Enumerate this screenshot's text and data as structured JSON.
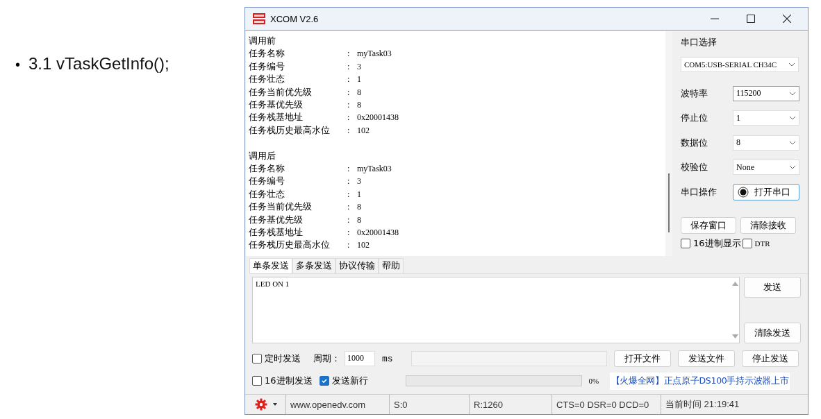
{
  "slide": {
    "bullet": "•",
    "heading": "3.1 vTaskGetInfo();"
  },
  "window": {
    "title": "XCOM V2.6"
  },
  "receive": {
    "sections": [
      {
        "heading": "调用前",
        "rows": [
          {
            "label": "任务名称",
            "separator": ":",
            "value": "myTask03"
          },
          {
            "label": "任务编号",
            "separator": ":",
            "value": "3"
          },
          {
            "label": "任务壮态",
            "separator": ":",
            "value": "1"
          },
          {
            "label": "任务当前优先级",
            "separator": ":",
            "value": "8"
          },
          {
            "label": "任务基优先级",
            "separator": ":",
            "value": "8"
          },
          {
            "label": "任务栈基地址",
            "separator": ":",
            "value": "0x20001438"
          },
          {
            "label": "任务栈历史最高水位",
            "separator": ":",
            "value": "102"
          }
        ]
      },
      {
        "heading": "调用后",
        "rows": [
          {
            "label": "任务名称",
            "separator": ":",
            "value": "myTask03"
          },
          {
            "label": "任务编号",
            "separator": ":",
            "value": "3"
          },
          {
            "label": "任务壮态",
            "separator": ":",
            "value": "1"
          },
          {
            "label": "任务当前优先级",
            "separator": ":",
            "value": "8"
          },
          {
            "label": "任务基优先级",
            "separator": ":",
            "value": "8"
          },
          {
            "label": "任务栈基地址",
            "separator": ":",
            "value": "0x20001438"
          },
          {
            "label": "任务栈历史最高水位",
            "separator": ":",
            "value": "102"
          }
        ]
      }
    ]
  },
  "serial_panel": {
    "port_label": "串口选择",
    "port": "COM5:USB-SERIAL CH34C",
    "settings": [
      {
        "label": "波特率",
        "value": "115200"
      },
      {
        "label": "停止位",
        "value": "1"
      },
      {
        "label": "数据位",
        "value": "8"
      },
      {
        "label": "校验位",
        "value": "None"
      }
    ],
    "operation": {
      "label": "串口操作",
      "button": "打开串口"
    },
    "buttons": [
      "保存窗口",
      "清除接收"
    ],
    "checkboxes": [
      {
        "label": "16进制显示",
        "checked": false
      },
      {
        "label": "DTR",
        "checked": false
      }
    ]
  },
  "send_tabs": [
    {
      "label": "单条发送",
      "selected": true
    },
    {
      "label": "多条发送",
      "selected": false
    },
    {
      "label": "协议传输",
      "selected": false
    },
    {
      "label": "帮助",
      "selected": false
    }
  ],
  "send_text": "LED ON 1",
  "send_buttons": [
    "发送",
    "清除发送"
  ],
  "timed_send": {
    "label": "定时发送",
    "checked": false
  },
  "period": {
    "label": "周期：",
    "value": "1000",
    "unit": "ms"
  },
  "file_buttons": [
    "打开文件",
    "发送文件",
    "停止发送"
  ],
  "options": [
    {
      "label": "16进制发送",
      "checked": false
    },
    {
      "label": "发送新行",
      "checked": true
    }
  ],
  "progress": {
    "level": 0,
    "reading": "0%"
  },
  "ad_link": "【火爆全网】正点原子DS100手持示波器上市",
  "status_bar": {
    "url": "www.openedv.com",
    "sent": "S:0",
    "received": "R:1260",
    "lines": "CTS=0 DSR=0 DCD=0",
    "time": "当前时间 21:19:41"
  }
}
